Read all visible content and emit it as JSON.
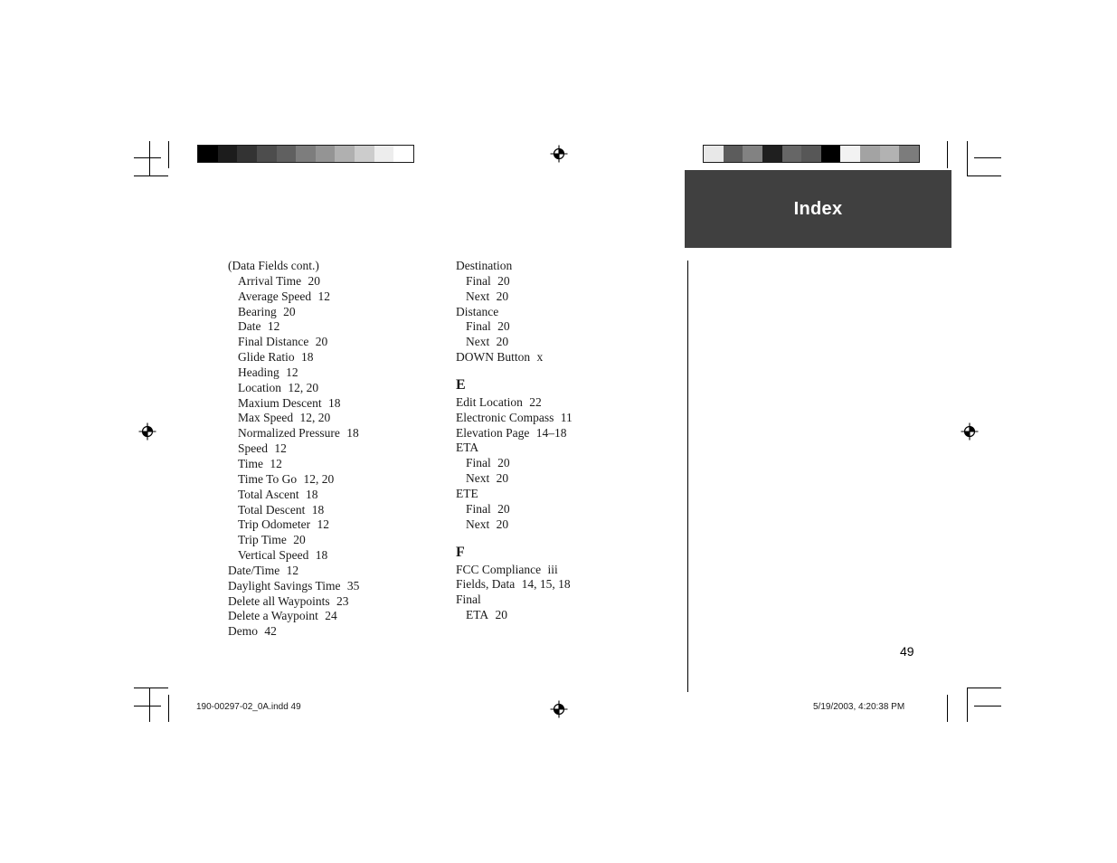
{
  "header": {
    "title": "Index",
    "block_color": "#404040",
    "title_color": "#ffffff"
  },
  "page_number": "49",
  "footer": {
    "filename": "190-00297-02_0A.indd   49",
    "timestamp": "5/19/2003, 4:20:38 PM"
  },
  "calibration_strips": {
    "left": {
      "name": "grayscale-ramp",
      "patches": [
        "#000000",
        "#1c1c1c",
        "#333333",
        "#4d4d4d",
        "#606060",
        "#7d7d7d",
        "#949494",
        "#b0b0b0",
        "#cccccc",
        "#ededed",
        "#ffffff"
      ]
    },
    "right": {
      "name": "scrambled-grayscale",
      "patches": [
        "#e8e8e8",
        "#5c5c5c",
        "#828282",
        "#1f1f1f",
        "#666666",
        "#575757",
        "#000000",
        "#f2f2f2",
        "#a3a3a3",
        "#b2b2b2",
        "#7c7c7c"
      ]
    }
  },
  "columns": [
    {
      "id": "col-1",
      "entries": [
        {
          "type": "entry",
          "level": 1,
          "text": "(Data Fields cont.)",
          "pages": ""
        },
        {
          "type": "entry",
          "level": 2,
          "text": "Arrival Time",
          "pages": "20"
        },
        {
          "type": "entry",
          "level": 2,
          "text": "Average Speed",
          "pages": "12"
        },
        {
          "type": "entry",
          "level": 2,
          "text": "Bearing",
          "pages": "20"
        },
        {
          "type": "entry",
          "level": 2,
          "text": "Date",
          "pages": "12"
        },
        {
          "type": "entry",
          "level": 2,
          "text": "Final Distance",
          "pages": "20"
        },
        {
          "type": "entry",
          "level": 2,
          "text": "Glide Ratio",
          "pages": "18"
        },
        {
          "type": "entry",
          "level": 2,
          "text": "Heading",
          "pages": "12"
        },
        {
          "type": "entry",
          "level": 2,
          "text": "Location",
          "pages": "12, 20"
        },
        {
          "type": "entry",
          "level": 2,
          "text": "Maxium Descent",
          "pages": "18"
        },
        {
          "type": "entry",
          "level": 2,
          "text": "Max Speed",
          "pages": "12, 20"
        },
        {
          "type": "entry",
          "level": 2,
          "text": "Normalized Pressure",
          "pages": "18"
        },
        {
          "type": "entry",
          "level": 2,
          "text": "Speed",
          "pages": "12"
        },
        {
          "type": "entry",
          "level": 2,
          "text": "Time",
          "pages": "12"
        },
        {
          "type": "entry",
          "level": 2,
          "text": "Time To Go",
          "pages": "12, 20"
        },
        {
          "type": "entry",
          "level": 2,
          "text": "Total Ascent",
          "pages": "18"
        },
        {
          "type": "entry",
          "level": 2,
          "text": "Total Descent",
          "pages": "18"
        },
        {
          "type": "entry",
          "level": 2,
          "text": "Trip Odometer",
          "pages": "12"
        },
        {
          "type": "entry",
          "level": 2,
          "text": "Trip Time",
          "pages": "20"
        },
        {
          "type": "entry",
          "level": 2,
          "text": "Vertical Speed",
          "pages": "18"
        },
        {
          "type": "entry",
          "level": 1,
          "text": "Date/Time",
          "pages": "12"
        },
        {
          "type": "entry",
          "level": 1,
          "text": "Daylight Savings Time",
          "pages": "35"
        },
        {
          "type": "entry",
          "level": 1,
          "text": "Delete all Waypoints",
          "pages": "23"
        },
        {
          "type": "entry",
          "level": 1,
          "text": "Delete a Waypoint",
          "pages": "24"
        },
        {
          "type": "entry",
          "level": 1,
          "text": "Demo",
          "pages": "42"
        }
      ]
    },
    {
      "id": "col-2",
      "entries": [
        {
          "type": "entry",
          "level": 1,
          "text": "Destination",
          "pages": ""
        },
        {
          "type": "entry",
          "level": 2,
          "text": "Final",
          "pages": "20"
        },
        {
          "type": "entry",
          "level": 2,
          "text": "Next",
          "pages": "20"
        },
        {
          "type": "entry",
          "level": 1,
          "text": "Distance",
          "pages": ""
        },
        {
          "type": "entry",
          "level": 2,
          "text": "Final",
          "pages": "20"
        },
        {
          "type": "entry",
          "level": 2,
          "text": "Next",
          "pages": "20"
        },
        {
          "type": "entry",
          "level": 1,
          "text": "DOWN Button",
          "pages": "x"
        },
        {
          "type": "section",
          "letter": "E"
        },
        {
          "type": "entry",
          "level": 1,
          "text": "Edit Location",
          "pages": "22"
        },
        {
          "type": "entry",
          "level": 1,
          "text": "Electronic Compass",
          "pages": "11"
        },
        {
          "type": "entry",
          "level": 1,
          "text": "Elevation Page",
          "pages": "14–18"
        },
        {
          "type": "entry",
          "level": 1,
          "text": "ETA",
          "pages": ""
        },
        {
          "type": "entry",
          "level": 2,
          "text": "Final",
          "pages": "20"
        },
        {
          "type": "entry",
          "level": 2,
          "text": "Next",
          "pages": "20"
        },
        {
          "type": "entry",
          "level": 1,
          "text": "ETE",
          "pages": ""
        },
        {
          "type": "entry",
          "level": 2,
          "text": "Final",
          "pages": "20"
        },
        {
          "type": "entry",
          "level": 2,
          "text": "Next",
          "pages": "20"
        },
        {
          "type": "section",
          "letter": "F"
        },
        {
          "type": "entry",
          "level": 1,
          "text": "FCC Compliance",
          "pages": "iii"
        },
        {
          "type": "entry",
          "level": 1,
          "text": "Fields, Data",
          "pages": "14, 15, 18"
        },
        {
          "type": "entry",
          "level": 1,
          "text": "Final",
          "pages": ""
        },
        {
          "type": "entry",
          "level": 2,
          "text": "ETA",
          "pages": "20"
        }
      ]
    }
  ]
}
